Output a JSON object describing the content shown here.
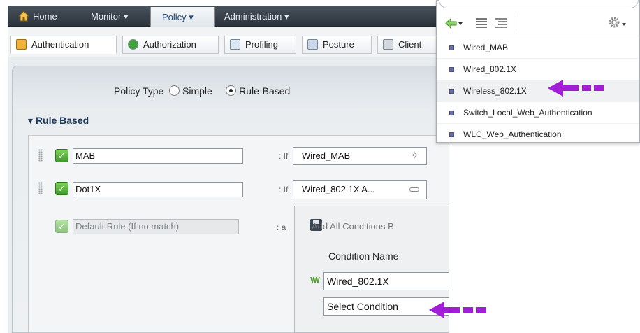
{
  "topnav": {
    "home": "Home",
    "monitor": "Monitor ▾",
    "policy": "Policy ▾",
    "administration": "Administration ▾"
  },
  "subtabs": {
    "authentication": "Authentication",
    "authorization": "Authorization",
    "profiling": "Profiling",
    "posture": "Posture",
    "client": "Client"
  },
  "policy_type": {
    "label": "Policy Type",
    "simple": "Simple",
    "rule_based": "Rule-Based",
    "selected": "Rule-Based"
  },
  "section": {
    "title": "▾ Rule Based"
  },
  "rules": [
    {
      "name": "MAB",
      "if_label": ": If",
      "condition": "Wired_MAB",
      "enabled": true
    },
    {
      "name": "Dot1X",
      "if_label": ": If",
      "condition": "Wired_802.1X A...",
      "enabled": true
    },
    {
      "name": "Default Rule (If no match)",
      "if_label": ": a",
      "enabled": true
    }
  ],
  "condition_popup": {
    "add_all": "Add All Conditions B",
    "header": "Condition Name",
    "rows": [
      "Wired_802.1X",
      "Select Condition"
    ]
  },
  "dropdown": {
    "items": [
      "Wired_MAB",
      "Wired_802.1X",
      "Wireless_802.1X",
      "Switch_Local_Web_Authentication",
      "WLC_Web_Authentication"
    ],
    "highlighted": "Wireless_802.1X"
  },
  "colors": {
    "annotation_arrow": "#a21ed6",
    "nav_bar": "#3a434c",
    "checkbox_green": "#58b63a"
  }
}
